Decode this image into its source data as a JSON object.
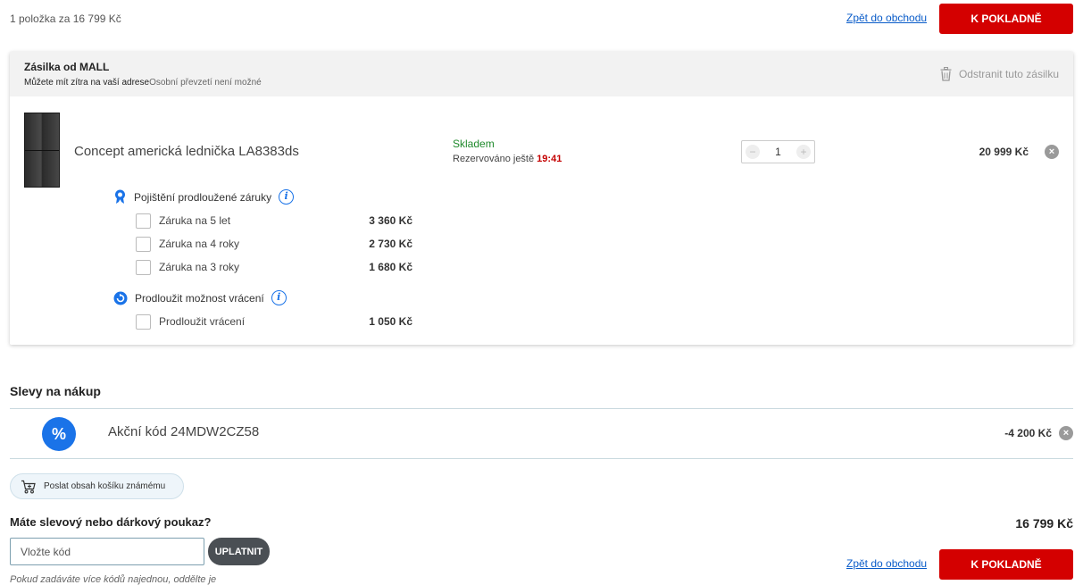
{
  "top": {
    "summary": "1 položka za 16 799 Kč",
    "back_label": "Zpět do obchodu",
    "checkout_label": "K POKLADNĚ"
  },
  "shipment": {
    "title": "Zásilka od MALL",
    "delivery_note": "Můžete mít zítra na vaší adrese",
    "pickup_note": "Osobní převzetí není možné",
    "remove_label": "Odstranit tuto zásilku",
    "item": {
      "name": "Concept americká lednička LA8383ds",
      "stock": "Skladem",
      "reserved_prefix": "Rezervováno ještě",
      "reserved_time": "19:41",
      "quantity": "1",
      "qty_minus": "−",
      "qty_plus": "+",
      "price": "20 999 Kč",
      "remove_glyph": "×"
    },
    "warranty": {
      "title": "Pojištění prodloužené záruky",
      "info_glyph": "i",
      "options": [
        {
          "label": "Záruka na 5 let",
          "price": "3 360 Kč"
        },
        {
          "label": "Záruka na 4 roky",
          "price": "2 730 Kč"
        },
        {
          "label": "Záruka na 3 roky",
          "price": "1 680 Kč"
        }
      ]
    },
    "returns": {
      "title": "Prodloužit možnost vrácení",
      "info_glyph": "i",
      "options": [
        {
          "label": "Prodloužit vrácení",
          "price": "1 050 Kč"
        }
      ]
    }
  },
  "discounts": {
    "title": "Slevy na nákup",
    "icon_glyph": "%",
    "code_label": "Akční kód 24MDW2CZ58",
    "value": "-4 200 Kč",
    "remove_glyph": "×"
  },
  "share": {
    "label": "Poslat obsah košíku známému"
  },
  "voucher": {
    "title": "Máte slevový nebo dárkový poukaz?",
    "placeholder": "Vložte kód",
    "apply_label": "UPLATNIT",
    "hint": "Pokud zadáváte více kódů najednou, oddělte je"
  },
  "bottom": {
    "total": "16 799 Kč",
    "back_label": "Zpět do obchodu",
    "checkout_label": "K POKLADNĚ"
  },
  "colors": {
    "accent_red": "#d40000",
    "link_blue": "#0a5cc9",
    "icon_blue": "#1a73e8",
    "stock_green": "#1f8a2c"
  }
}
